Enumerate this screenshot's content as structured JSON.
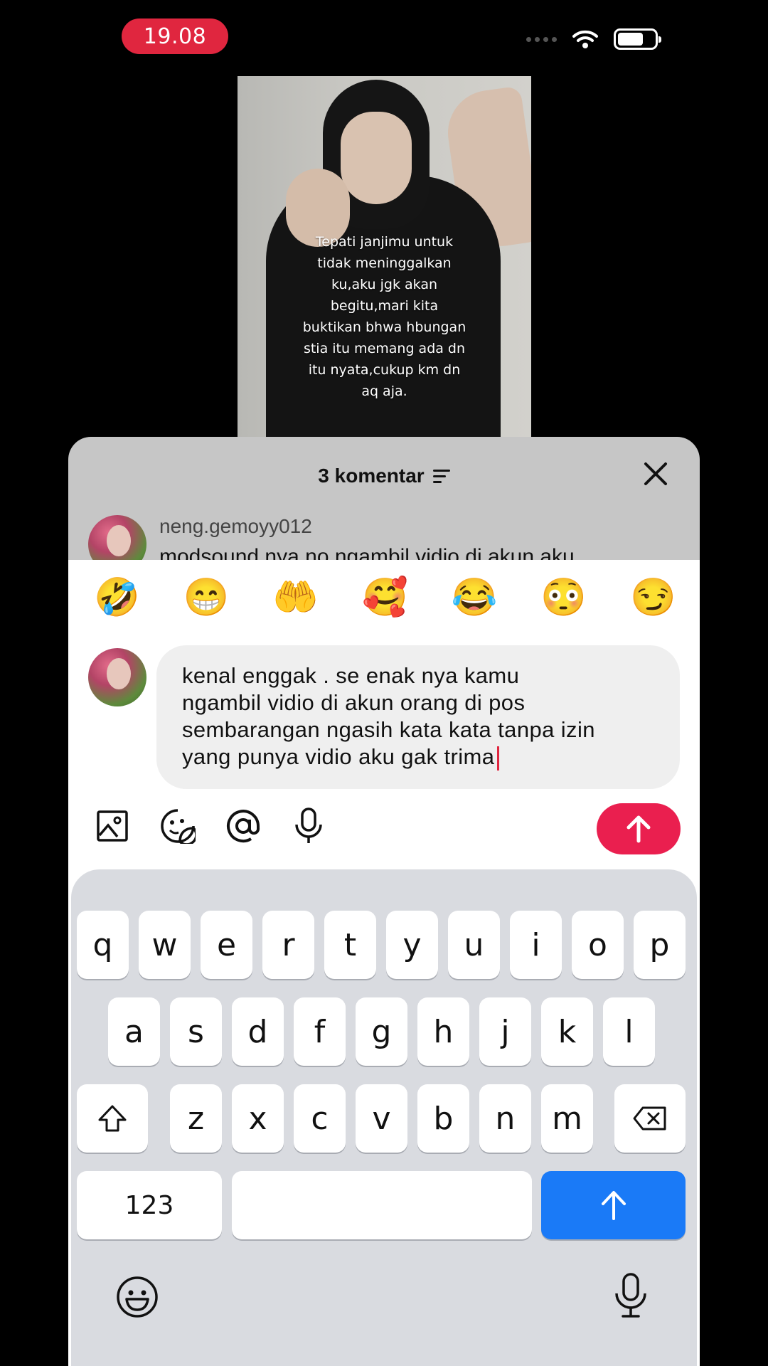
{
  "status": {
    "time": "19.08"
  },
  "video": {
    "caption": "Tepati janjimu untuk tidak meninggalkan ku,aku jgk akan begitu,mari kita buktikan bhwa hbungan stia itu memang ada dn itu nyata,cukup km dn aq aja."
  },
  "sheet": {
    "title": "3 komentar",
    "preview_comment": {
      "username": "neng.gemoyy012",
      "text": "modsound nya no ngambil vidio di akun aku"
    }
  },
  "emoji_bar": [
    "🤣",
    "😁",
    "🤲",
    "🥰",
    "😂",
    "😳",
    "😏"
  ],
  "comment_input": {
    "lines": [
      "kenal enggak . se enak nya kamu",
      "ngambil vidio di akun orang di pos",
      "sembarangan ngasih kata kata tanpa izin",
      "yang punya vidio aku gak trima"
    ]
  },
  "toolbar": {
    "icons": [
      "image-icon",
      "sticker-icon",
      "mention-icon",
      "mic-icon"
    ],
    "send_color": "#ea1f4f"
  },
  "keyboard": {
    "row1": [
      "q",
      "w",
      "e",
      "r",
      "t",
      "y",
      "u",
      "i",
      "o",
      "p"
    ],
    "row2": [
      "a",
      "s",
      "d",
      "f",
      "g",
      "h",
      "j",
      "k",
      "l"
    ],
    "row3": [
      "z",
      "x",
      "c",
      "v",
      "b",
      "n",
      "m"
    ],
    "numbers_label": "123",
    "return_color": "#1a7af7"
  }
}
